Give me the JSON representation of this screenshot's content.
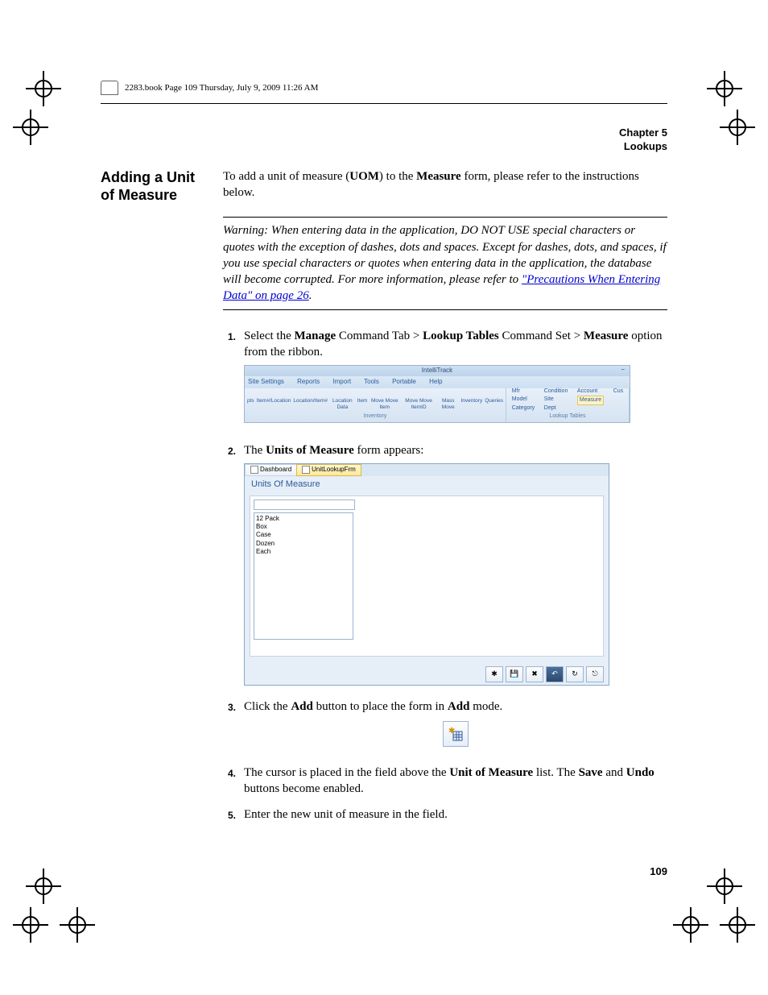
{
  "header": {
    "frame_info": "2283.book  Page 109  Thursday, July 9, 2009  11:26 AM"
  },
  "chapter": {
    "label": "Chapter 5",
    "title": "Lookups"
  },
  "section": {
    "heading": "Adding a Unit of Measure",
    "intro_before": "To add a unit of measure (",
    "intro_uom": "UOM",
    "intro_mid": ") to the ",
    "intro_measure": "Measure",
    "intro_after": " form, please refer to the instructions below."
  },
  "warning": {
    "prefix": "Warning:   ",
    "text": "When entering data in the application, DO NOT USE special characters or quotes with the exception of dashes, dots and spaces. Except for dashes, dots, and spaces, if you use special characters or quotes when entering data in the application, the database will become corrupted. For more information, please refer to ",
    "link": "\"Precautions When Entering Data\" on page 26",
    "suffix": "."
  },
  "steps": {
    "s1": {
      "num": "1.",
      "a": "Select the ",
      "b": "Manage",
      "c": " Command Tab > ",
      "d": "Lookup Tables",
      "e": " Command Set > ",
      "f": "Measure",
      "g": " option from the ribbon."
    },
    "s2": {
      "num": "2.",
      "a": "The ",
      "b": "Units of Measure",
      "c": " form appears:"
    },
    "s3": {
      "num": "3.",
      "a": "Click the ",
      "b": "Add",
      "c": " button to place the form in ",
      "d": "Add",
      "e": " mode."
    },
    "s4": {
      "num": "4.",
      "a": "The cursor is placed in the field above the ",
      "b": "Unit of Measure",
      "c": " list. The ",
      "d": "Save",
      "e": " and ",
      "f": "Undo",
      "g": " buttons become enabled."
    },
    "s5": {
      "num": "5.",
      "a": "Enter the new unit of measure in the field."
    }
  },
  "ribbon": {
    "title": "IntelliTrack",
    "tabs": [
      "Site Settings",
      "Reports",
      "Import",
      "Tools",
      "Portable",
      "Help"
    ],
    "inventory": {
      "items": [
        "pts",
        "Item#/Location",
        "Location/Item#",
        "Location Data",
        "Item",
        "Move Move Item",
        "Move Move ItemID",
        "Mass Move",
        "Inventory",
        "Queries"
      ],
      "group": "Inventory"
    },
    "lookup": {
      "col1": [
        "Mfr",
        "Model",
        "Category"
      ],
      "col2": [
        "Condition",
        "Site",
        "Dept"
      ],
      "col3": [
        "Account",
        "Measure"
      ],
      "cus": "Cus",
      "group": "Lookup Tables"
    }
  },
  "uom": {
    "tab_dashboard": "Dashboard",
    "tab_form": "UnitLookupFrm",
    "title": "Units Of Measure",
    "items": [
      "12 Pack",
      "Box",
      "Case",
      "Dozen",
      "Each"
    ]
  },
  "page_number": "109"
}
